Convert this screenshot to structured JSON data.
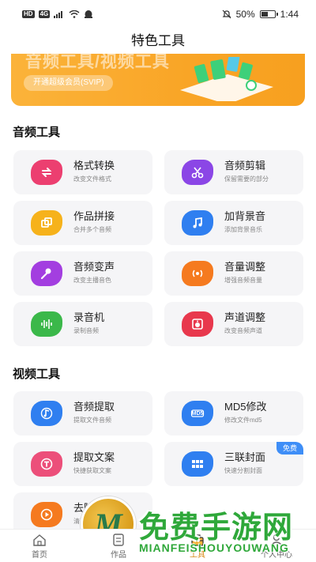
{
  "status_bar": {
    "left_badges": [
      "HD",
      "4G"
    ],
    "battery_percent": "50%",
    "battery_level": 0.5,
    "time": "1:44"
  },
  "header": {
    "title": "特色工具"
  },
  "banner": {
    "title": "音频工具/视频工具",
    "button_label": "开通超级会员(SVIP)"
  },
  "audio_section": {
    "title": "音频工具",
    "tools": [
      {
        "name": "格式转换",
        "desc": "改变文件格式",
        "icon": "swap-icon",
        "color": "#ec3f70"
      },
      {
        "name": "音频剪辑",
        "desc": "保留需要的部分",
        "icon": "scissors-icon",
        "color": "#8b46e6"
      },
      {
        "name": "作品拼接",
        "desc": "合并多个音频",
        "icon": "merge-icon",
        "color": "#f6b21b"
      },
      {
        "name": "加背景音",
        "desc": "添加背景音乐",
        "icon": "music-note-icon",
        "color": "#2f7ff0"
      },
      {
        "name": "音频变声",
        "desc": "改变主播音色",
        "icon": "microphone-icon",
        "color": "#a33ee0"
      },
      {
        "name": "音量调整",
        "desc": "增强音频音量",
        "icon": "volume-icon",
        "color": "#f57a1f"
      },
      {
        "name": "录音机",
        "desc": "录制音频",
        "icon": "waveform-icon",
        "color": "#3bb84a"
      },
      {
        "name": "声道调整",
        "desc": "改变音频声道",
        "icon": "speaker-icon",
        "color": "#e8384d"
      }
    ]
  },
  "video_section": {
    "title": "视频工具",
    "tools": [
      {
        "name": "音频提取",
        "desc": "提取文件音频",
        "icon": "music-extract-icon",
        "color": "#2f7ff0"
      },
      {
        "name": "MD5修改",
        "desc": "修改文件md5",
        "icon": "md5-icon",
        "color": "#2f7ff0",
        "icon_text": "MD5"
      },
      {
        "name": "提取文案",
        "desc": "快捷获取文案",
        "icon": "text-extract-icon",
        "color": "#ec4f7a"
      },
      {
        "name": "三联封面",
        "desc": "快速分割封面",
        "icon": "grid-icon",
        "color": "#2f7ff0",
        "badge": "免费"
      },
      {
        "name": "去除水印",
        "desc": "清除水印",
        "icon": "play-icon",
        "color": "#f57a1f"
      }
    ]
  },
  "bottom_nav": {
    "items": [
      {
        "label": "首页",
        "icon": "home-icon",
        "active": false
      },
      {
        "label": "作品",
        "icon": "works-icon",
        "active": false
      },
      {
        "label": "工具",
        "icon": "toolbox-icon",
        "active": true
      },
      {
        "label": "个人中心",
        "icon": "user-icon",
        "active": false
      }
    ]
  },
  "watermark": {
    "logo_letter": "M",
    "main_text": "免费手游网",
    "sub_text": "MIANFEISHOUYOUWANG"
  }
}
